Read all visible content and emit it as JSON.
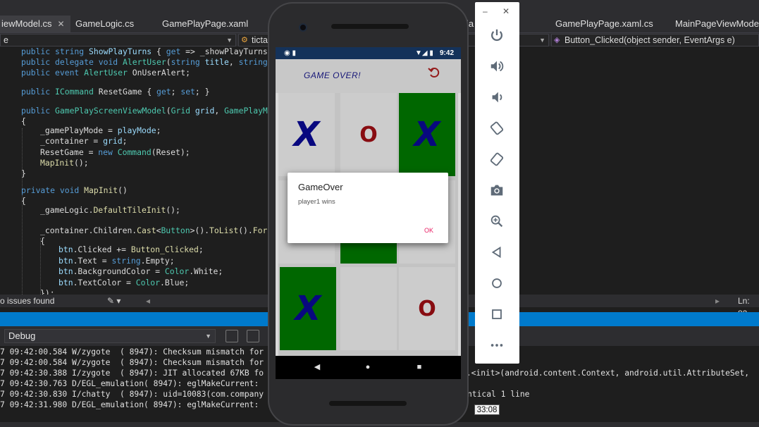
{
  "vs": {
    "tabs": [
      {
        "label": "iewModel.cs",
        "active": true,
        "close": "✕"
      },
      {
        "label": "GameLogic.cs"
      },
      {
        "label": "GamePlayPage.xaml"
      },
      {
        "label": "la"
      },
      {
        "label": "GamePlayPage.xaml.cs"
      },
      {
        "label": "MainPageViewModel.c"
      }
    ],
    "nav": {
      "left": "e",
      "middle": "ticta",
      "right": "Button_Clicked(object sender, EventArgs e)"
    },
    "code_lines": [
      "public string ShowPlayTurns { get => _showPlayTurns;",
      "public delegate void AlertUser(string title, string m",
      "public event AlertUser OnUserAlert;",
      "",
      "public ICommand ResetGame { get; set; }",
      "",
      "public GamePlayScreenViewModel(Grid grid, GamePlayMode",
      "{",
      "    _gamePlayMode = playMode;",
      "    _container = grid;",
      "    ResetGame = new Command(Reset);",
      "    MapInit();",
      "}",
      "",
      "private void MapInit()",
      "{",
      "    _gameLogic.DefaultTileInit();",
      "",
      "    _container.Children.Cast<Button>().ToList().ForEa",
      "    {",
      "        btn.Clicked += Button_Clicked;",
      "        btn.Text = string.Empty;",
      "        btn.BackgroundColor = Color.White;",
      "        btn.TextColor = Color.Blue;",
      "    });"
    ],
    "editor_status": {
      "issues": "o issues found",
      "position": "Ln: 82"
    },
    "output": {
      "dropdown": "Debug",
      "lines": [
        "7 09:42:00.584 W/zygote  ( 8947): Checksum mismatch for",
        "7 09:42:00.584 W/zygote  ( 8947): Checksum mismatch for",
        "7 09:42:30.388 I/zygote  ( 8947): JIT allocated 67KB fo",
        "7 09:42:30.763 D/EGL_emulation( 8947): eglMakeCurrent:",
        "7 09:42:30.830 I/chatty  ( 8947): uid=10083(com.company",
        "7 09:42:31.980 D/EGL_emulation( 8947): eglMakeCurrent:"
      ],
      "right_fragments": [
        {
          "text": "w.<init>(android.content.Context, android.util.AttributeSet,"
        },
        {
          "text": "ntical 1 line"
        }
      ]
    },
    "timestamp_tip": "33:08"
  },
  "phone": {
    "status_time": "9:42",
    "app_title": "GAME OVER!",
    "grid": [
      {
        "mark": "X",
        "green": false
      },
      {
        "mark": "O",
        "green": false
      },
      {
        "mark": "X",
        "green": true
      },
      {
        "mark": "",
        "green": false
      },
      {
        "mark": "",
        "green": true
      },
      {
        "mark": "",
        "green": false
      },
      {
        "mark": "X",
        "green": true
      },
      {
        "mark": "",
        "green": false
      },
      {
        "mark": "O",
        "green": false
      }
    ],
    "dialog": {
      "title": "GameOver",
      "message": "player1 wins",
      "ok": "OK"
    },
    "colors": {
      "statusbar": "#14325a",
      "cell_green": "#007a00",
      "x": "#0a0a96",
      "o": "#a00f14",
      "dialog_ok": "#e91e63"
    }
  },
  "emulator": {
    "window": {
      "minimize": "–",
      "close": "✕"
    },
    "buttons": [
      "power-icon",
      "volume-up-icon",
      "volume-down-icon",
      "rotate-left-icon",
      "rotate-right-icon",
      "camera-icon",
      "zoom-icon",
      "back-icon",
      "home-icon",
      "overview-icon",
      "more-icon"
    ]
  }
}
